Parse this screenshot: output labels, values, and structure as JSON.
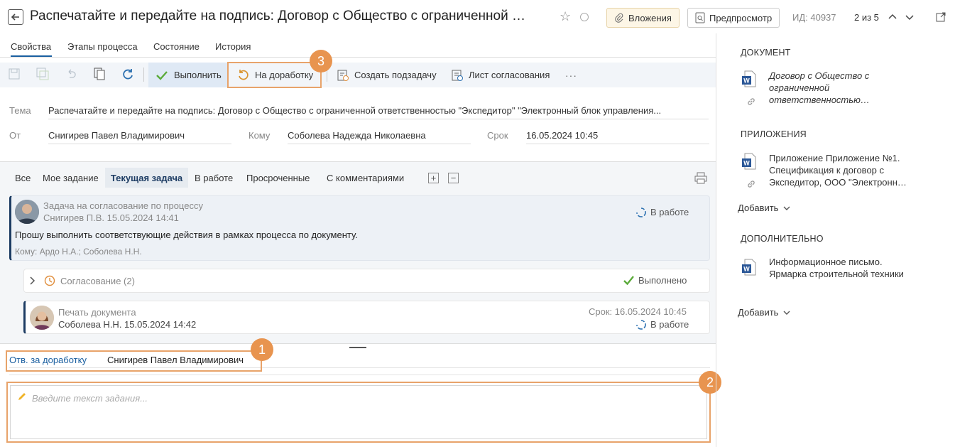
{
  "header": {
    "title": "Распечатайте и передайте на подпись: Договор с Общество с ограниченной …",
    "attachments_label": "Вложения",
    "preview_label": "Предпросмотр",
    "id_label": "ИД: 40937",
    "pager": "2 из 5"
  },
  "tabs": [
    "Свойства",
    "Этапы процесса",
    "Состояние",
    "История"
  ],
  "toolbar": {
    "execute_label": "Выполнить",
    "rework_label": "На доработку",
    "subtask_label": "Создать подзадачу",
    "approval_sheet_label": "Лист согласования",
    "more_label": "···"
  },
  "fields": {
    "subject_label": "Тема",
    "subject_value": "Распечатайте и передайте на подпись: Договор с Общество с ограниченной ответственностью \"Экспедитор\" \"Электронный блок управления...",
    "from_label": "От",
    "from_value": "Снигирев Павел Владимирович",
    "to_label": "Кому",
    "to_value": "Соболева Надежда Николаевна",
    "due_label": "Срок",
    "due_value": "16.05.2024 10:45"
  },
  "filters": [
    "Все",
    "Мое задание",
    "Текущая задача",
    "В работе",
    "Просроченные",
    "С комментариями"
  ],
  "thread": {
    "task": {
      "title": "Задача на согласование по процессу",
      "author_date": "Снигирев П.В.  15.05.2024 14:41",
      "status": "В работе",
      "text": "Прошу выполнить соответствующие действия в рамках процесса по документу.",
      "recipients": "Кому: Ардо Н.А.; Соболева Н.Н."
    },
    "approval": {
      "title": "Согласование (2)",
      "status": "Выполнено"
    },
    "print": {
      "title": "Печать документа",
      "author_date": "Соболева Н.Н.  15.05.2024 14:42",
      "due": "Срок: 16.05.2024 10:45",
      "status": "В работе"
    }
  },
  "rework": {
    "resp_label": "Отв. за доработку",
    "resp_value": "Снигирев Павел Владимирович",
    "placeholder": "Введите текст задания..."
  },
  "markers": [
    "1",
    "2",
    "3"
  ],
  "right": {
    "document_heading": "ДОКУМЕНТ",
    "document_link_1": "Договор с Общество с",
    "document_link_2": "ограниченной",
    "document_link_3": "ответственностью…",
    "attachments_heading": "ПРИЛОЖЕНИЯ",
    "attachment_1": "Приложение Приложение №1.",
    "attachment_2": "Спецификация к договор с",
    "attachment_3": "Экспедитор, ООО \"Электронн…",
    "add_label": "Добавить",
    "additional_heading": "ДОПОЛНИТЕЛЬНО",
    "additional_1": "Информационное письмо.",
    "additional_2": "Ярмарка строительной техники"
  },
  "colors": {
    "accent": "#1a5fa0",
    "marker": "#e8944f",
    "done": "#5cab3b"
  }
}
